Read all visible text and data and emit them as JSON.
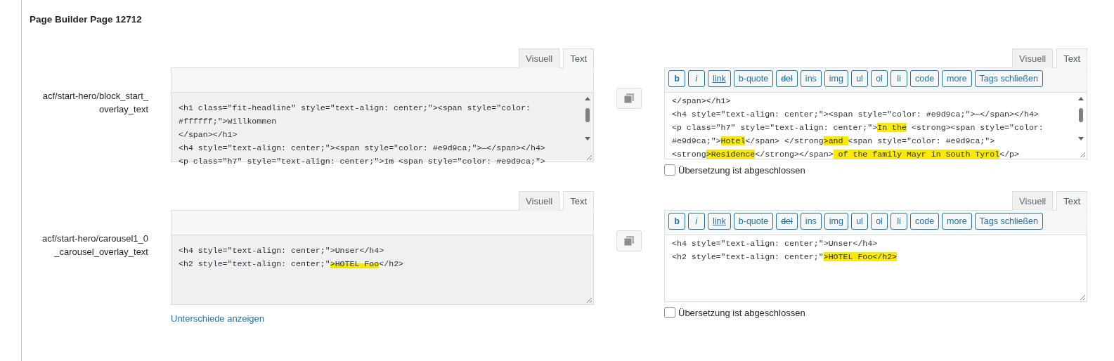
{
  "heading": "Page Builder Page 12712",
  "rows": [
    {
      "label_lines": [
        "acf/start-hero/block_start_",
        "overlay_text"
      ],
      "source": {
        "tabs": [
          {
            "label": "Visuell",
            "selected": false
          },
          {
            "label": "Text",
            "selected": true
          }
        ],
        "scrollable": true,
        "lines": [
          [
            {
              "text": "<h1 class=\"fit-headline\" style=\"text-align: center;\"><span style=\"color:",
              "highlight": false
            }
          ],
          [
            {
              "text": "#ffffff;\">Willkommen",
              "highlight": false
            }
          ],
          [
            {
              "text": "</span></h1>",
              "highlight": false
            }
          ],
          [
            {
              "text": "<h4 style=\"text-align: center;\"><span style=\"color: #e9d9ca;\">—</span></h4>",
              "highlight": false
            }
          ],
          [
            {
              "text": "<p class=\"h7\" style=\"text-align: center;\">Im <span style=\"color: #e9d9ca;\">",
              "highlight": false
            }
          ]
        ]
      },
      "translation": {
        "tabs": [
          {
            "label": "Visuell",
            "selected": false
          },
          {
            "label": "Text",
            "selected": true
          }
        ],
        "toolbar": [
          {
            "label": "b",
            "kind": "bold"
          },
          {
            "label": "i",
            "kind": "italic"
          },
          {
            "label": "link",
            "kind": "link"
          },
          {
            "label": "b-quote",
            "kind": "plain"
          },
          {
            "label": "del",
            "kind": "strike"
          },
          {
            "label": "ins",
            "kind": "plain"
          },
          {
            "label": "img",
            "kind": "plain"
          },
          {
            "label": "ul",
            "kind": "plain"
          },
          {
            "label": "ol",
            "kind": "plain"
          },
          {
            "label": "li",
            "kind": "plain"
          },
          {
            "label": "code",
            "kind": "plain"
          },
          {
            "label": "more",
            "kind": "plain"
          },
          {
            "label": "Tags schließen",
            "kind": "plain"
          }
        ],
        "scrollable": true,
        "lines": [
          [
            {
              "text": "</span></h1>",
              "highlight": false
            }
          ],
          [
            {
              "text": "<h4 style=\"text-align: center;\"><span style=\"color: #e9d9ca;\">—</span></h4>",
              "highlight": false
            }
          ],
          [
            {
              "text": "<p class=\"h7\" style=\"text-align: center;\">",
              "highlight": false
            },
            {
              "text": "In the",
              "highlight": true
            },
            {
              "text": " <strong><span style=\"color:",
              "highlight": false
            }
          ],
          [
            {
              "text": "#e9d9ca;\">",
              "highlight": false
            },
            {
              "text": "Hotel",
              "highlight": true
            },
            {
              "text": "</span> </strong",
              "highlight": false
            },
            {
              "text": ">and ",
              "highlight": true
            },
            {
              "text": "<span style=\"color: #e9d9ca;\">",
              "highlight": false
            }
          ],
          [
            {
              "text": "<strong",
              "highlight": false
            },
            {
              "text": ">Residence",
              "highlight": true
            },
            {
              "text": "</strong></span>",
              "highlight": false
            },
            {
              "text": " of the family Mayr in South Tyrol",
              "highlight": true
            },
            {
              "text": "</p>",
              "highlight": false
            }
          ]
        ],
        "checkbox": {
          "label": "Übersetzung ist abgeschlossen",
          "checked": false
        }
      }
    },
    {
      "label_lines": [
        "acf/start-hero/carousel1_0",
        "_carousel_overlay_text"
      ],
      "source": {
        "tabs": [
          {
            "label": "Visuell",
            "selected": false
          },
          {
            "label": "Text",
            "selected": true
          }
        ],
        "scrollable": false,
        "lines": [
          [
            {
              "text": "<h4 style=\"text-align: center;\">Unser</h4>",
              "highlight": false
            }
          ],
          [
            {
              "text": "<h2 style=\"text-align: center;\"",
              "highlight": false
            },
            {
              "text": ">HOTEL Foo",
              "highlight": true
            },
            {
              "text": "</h2>",
              "highlight": false
            }
          ]
        ]
      },
      "diff_link": "Unterschiede anzeigen",
      "translation": {
        "tabs": [
          {
            "label": "Visuell",
            "selected": false
          },
          {
            "label": "Text",
            "selected": true
          }
        ],
        "toolbar": [
          {
            "label": "b",
            "kind": "bold"
          },
          {
            "label": "i",
            "kind": "italic"
          },
          {
            "label": "link",
            "kind": "link"
          },
          {
            "label": "b-quote",
            "kind": "plain"
          },
          {
            "label": "del",
            "kind": "strike"
          },
          {
            "label": "ins",
            "kind": "plain"
          },
          {
            "label": "img",
            "kind": "plain"
          },
          {
            "label": "ul",
            "kind": "plain"
          },
          {
            "label": "ol",
            "kind": "plain"
          },
          {
            "label": "li",
            "kind": "plain"
          },
          {
            "label": "code",
            "kind": "plain"
          },
          {
            "label": "more",
            "kind": "plain"
          },
          {
            "label": "Tags schließen",
            "kind": "plain"
          }
        ],
        "scrollable": false,
        "lines": [
          [
            {
              "text": "<h4 style=\"text-align: center;\">Unser</h4>",
              "highlight": false
            }
          ],
          [
            {
              "text": "<h2 style=\"text-align: center;\"",
              "highlight": false
            },
            {
              "text": ">HOTEL Foo</h2>",
              "highlight": true
            }
          ]
        ],
        "checkbox": {
          "label": "Übersetzung ist abgeschlossen",
          "checked": false
        }
      }
    }
  ]
}
